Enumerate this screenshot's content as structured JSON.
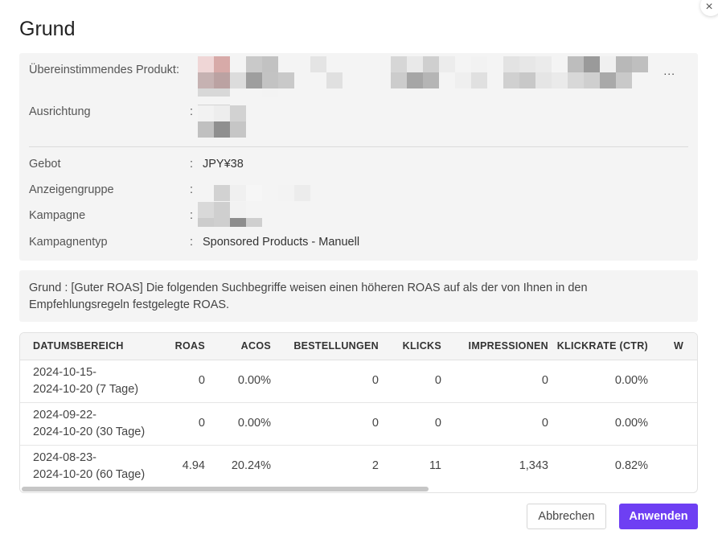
{
  "dialog": {
    "title": "Grund",
    "close_icon": "×"
  },
  "info": {
    "matched_product_label": "Übereinstimmendes Produkt:",
    "targeting_label": "Ausrichtung",
    "bid_label": "Gebot",
    "bid_value": "JPY¥38",
    "ad_group_label": "Anzeigengruppe",
    "campaign_label": "Kampagne",
    "campaign_type_label": "Kampagnentyp",
    "campaign_type_value": "Sponsored Products - Manuell",
    "colon": ":",
    "more": "..."
  },
  "reason": {
    "text": "Grund : [Guter ROAS] Die folgenden Suchbegriffe weisen einen höheren ROAS auf als der von Ihnen in den Empfehlungsregeln festgelegte ROAS."
  },
  "table": {
    "headers": [
      "DATUMSBEREICH",
      "ROAS",
      "ACOS",
      "BESTELLUNGEN",
      "KLICKS",
      "IMPRESSIONEN",
      "KLICKRATE (CTR)",
      "W"
    ],
    "rows": [
      {
        "range_start": "2024-10-15-",
        "range_end": "2024-10-20 (7 Tage)",
        "roas": "0",
        "acos": "0.00%",
        "orders": "0",
        "clicks": "0",
        "impressions": "0",
        "ctr": "0.00%"
      },
      {
        "range_start": "2024-09-22-",
        "range_end": "2024-10-20 (30 Tage)",
        "roas": "0",
        "acos": "0.00%",
        "orders": "0",
        "clicks": "0",
        "impressions": "0",
        "ctr": "0.00%"
      },
      {
        "range_start": "2024-08-23-",
        "range_end": "2024-10-20 (60 Tage)",
        "roas": "4.94",
        "acos": "20.24%",
        "orders": "2",
        "clicks": "11",
        "impressions": "1,343",
        "ctr": "0.82%"
      }
    ]
  },
  "buttons": {
    "cancel": "Abbrechen",
    "apply": "Anwenden"
  },
  "colors": {
    "accent": "#6e3ff3",
    "panel": "#f4f4f4"
  }
}
